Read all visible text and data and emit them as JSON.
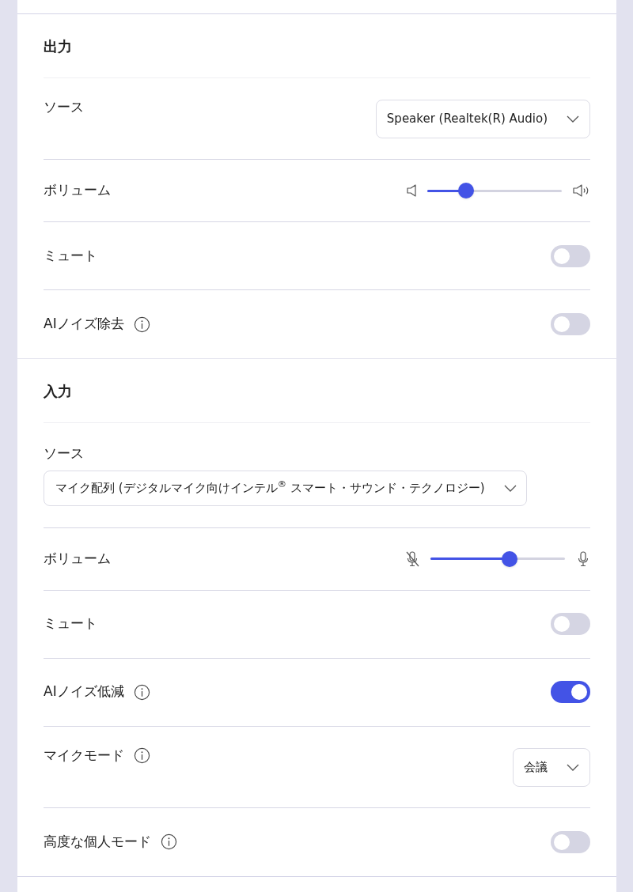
{
  "sections": [
    {
      "title": "出力",
      "rows": [
        {
          "kind": "select",
          "label": "ソース",
          "value": "Speaker (Realtek(R) Audio)",
          "wide": false,
          "info": false
        },
        {
          "kind": "slider",
          "label": "ボリューム",
          "level": 0.29,
          "info": false
        },
        {
          "kind": "toggle",
          "label": "ミュート",
          "on": false,
          "info": false
        },
        {
          "kind": "toggle",
          "label": "AIノイズ除去",
          "on": false,
          "info": true
        }
      ]
    },
    {
      "title": "入力",
      "rows": [
        {
          "kind": "select",
          "label": "ソース",
          "value": "マイク配列 (デジタルマイク向けインテル$^{®}$ スマート・サウンド・テクノロジー)",
          "wide": true,
          "info": false
        },
        {
          "kind": "slider",
          "label": "ボリューム",
          "level": 0.59,
          "info": false
        },
        {
          "kind": "toggle",
          "label": "ミュート",
          "on": false,
          "info": false
        },
        {
          "kind": "toggle",
          "label": "AIノイズ低減",
          "on": true,
          "info": true
        },
        {
          "kind": "select",
          "label": "マイクモード",
          "value": "会議",
          "wide": false,
          "info": true
        },
        {
          "kind": "toggle",
          "label": "高度な個人モード",
          "on": false,
          "info": true
        }
      ]
    }
  ]
}
